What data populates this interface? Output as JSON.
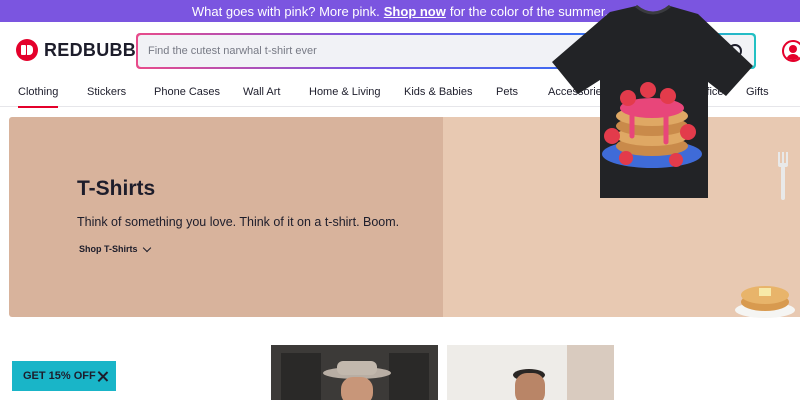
{
  "promo": {
    "text": "What goes with pink? More pink.",
    "link": "Shop now",
    "suffix": "for the color of the summer."
  },
  "header": {
    "logo_text": "REDBUBBLE",
    "search_placeholder": "Find the cutest narwhal t-shirt ever",
    "search_value": ""
  },
  "nav": {
    "items": [
      {
        "label": "Clothing",
        "active": true
      },
      {
        "label": "Stickers"
      },
      {
        "label": "Phone Cases"
      },
      {
        "label": "Wall Art"
      },
      {
        "label": "Home & Living"
      },
      {
        "label": "Kids & Babies"
      },
      {
        "label": "Pets"
      },
      {
        "label": "Accessories"
      },
      {
        "label": "Stationery & Office"
      },
      {
        "label": "Gifts"
      }
    ]
  },
  "hero": {
    "title": "T-Shirts",
    "subtitle": "Think of something you love. Think of it on a t-shirt. Boom.",
    "link": "Shop T-Shirts"
  },
  "discount": {
    "label": "GET 15% OFF"
  },
  "colors": {
    "promo_bg": "#7b55e0",
    "brand_red": "#e4002b",
    "hero_bg": "#d8b39c",
    "discount_bg": "#19b5c8"
  },
  "icons": [
    "redbubble-logo-icon",
    "search-icon",
    "account-icon",
    "chevron-down-icon",
    "close-icon"
  ]
}
